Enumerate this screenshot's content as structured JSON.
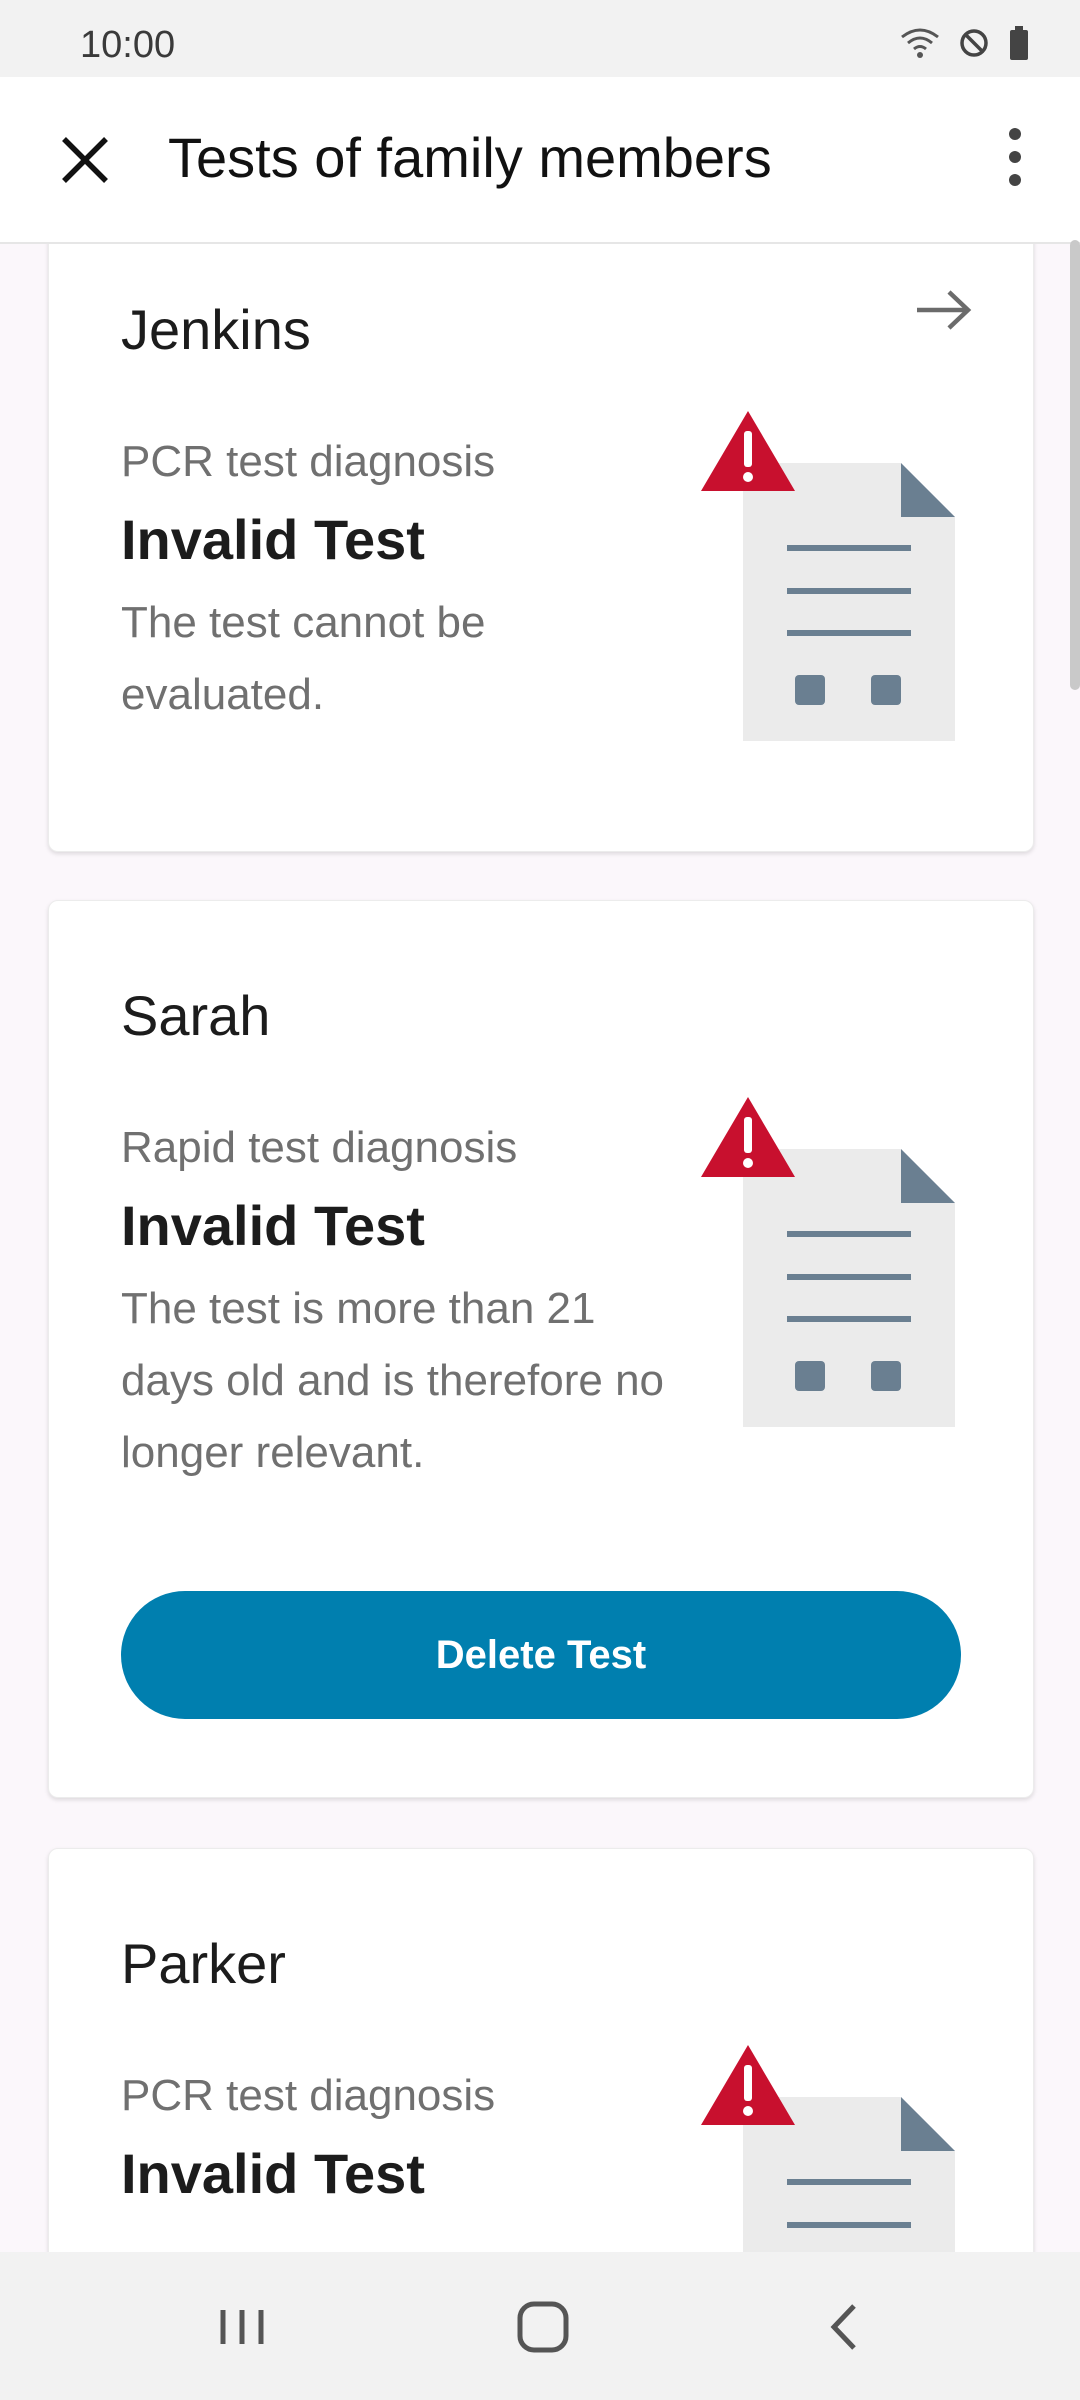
{
  "status_bar": {
    "time": "10:00",
    "icons": [
      "wifi-icon",
      "do-not-disturb-icon",
      "battery-icon"
    ]
  },
  "app_bar": {
    "title": "Tests of family members",
    "close_icon": "close-icon",
    "menu_icon": "more-vert-icon"
  },
  "cards": [
    {
      "name": "Jenkins",
      "diagnosis_type": "PCR test diagnosis",
      "result": "Invalid Test",
      "description": "The test cannot be evaluated.",
      "has_arrow": true
    },
    {
      "name": "Sarah",
      "diagnosis_type": "Rapid test diagnosis",
      "result": "Invalid Test",
      "description": "The test is more than 21 days old and is therefore no longer relevant.",
      "action": "Delete Test"
    },
    {
      "name": "Parker",
      "diagnosis_type": "PCR test diagnosis",
      "result": "Invalid Test"
    }
  ],
  "colors": {
    "accent": "#007faf",
    "warning": "#c8102e",
    "doc_bg": "#ebebeb",
    "doc_ink": "#6a7f91"
  },
  "nav_bar": [
    "recents-icon",
    "home-icon",
    "back-icon"
  ]
}
